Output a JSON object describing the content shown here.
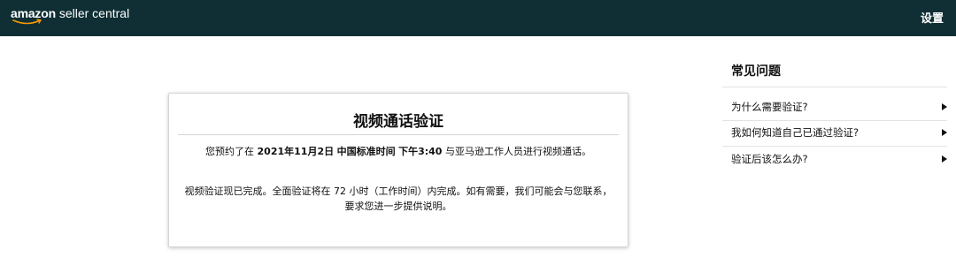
{
  "header": {
    "logo_brand": "amazon",
    "logo_product": "seller central",
    "settings_label": "设置"
  },
  "card": {
    "title": "视频通话验证",
    "appointment": {
      "prefix": "您预约了在",
      "date": "2021年11月2日",
      "timezone": "中国标准时间",
      "time": "下午3:40",
      "suffix": "与亚马逊工作人员进行视频通话。"
    },
    "note_line1": "视频验证现已完成。全面验证将在 72 小时（工作时间）内完成。如有需要，我们可能会与您联系，",
    "note_line2": "要求您进一步提供说明。"
  },
  "faq": {
    "title": "常见问题",
    "items": [
      {
        "label": "为什么需要验证?",
        "icon": "caret-right-icon"
      },
      {
        "label": "我如何知道自己已通过验证?",
        "icon": "caret-right-icon"
      },
      {
        "label": "验证后该怎么办?",
        "icon": "caret-right-icon"
      }
    ]
  },
  "colors": {
    "header_bg": "#0f2f35",
    "logo_smile": "#ff9900"
  }
}
